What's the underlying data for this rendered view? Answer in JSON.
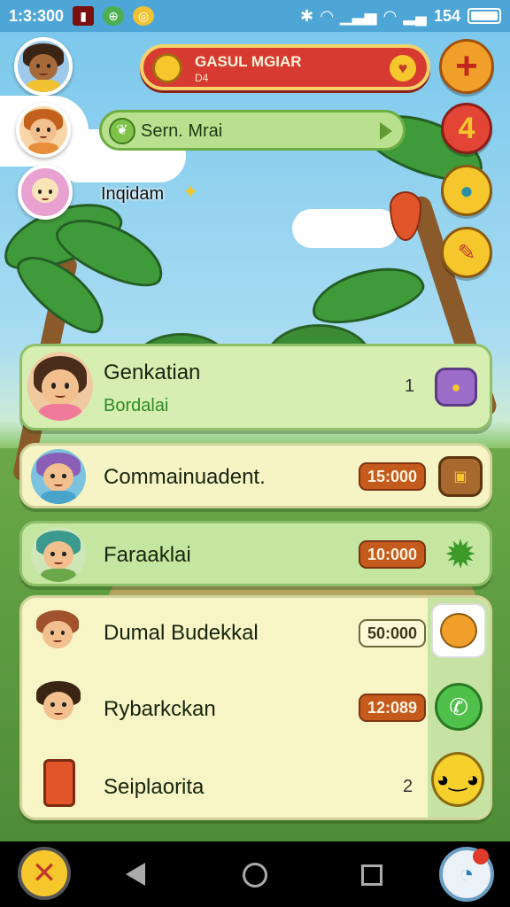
{
  "status_bar": {
    "time": "1:3:300",
    "battery_text": "154"
  },
  "top_banner": {
    "title": "GASUL MGIAR",
    "subtitle": "D4"
  },
  "side_buttons": {
    "plus": "+",
    "count": "4"
  },
  "search_pill": {
    "text": "Sern. Mrai"
  },
  "label_insta": "Inqidam",
  "cards": [
    {
      "title": "Genkatian",
      "subtitle": "Bordalai",
      "count": "1"
    },
    {
      "title": "Commainuadent.",
      "time": "15:000"
    },
    {
      "title": "Faraaklai",
      "time": "10:000"
    }
  ],
  "stack_items": [
    {
      "title": "Dumal Budekkal",
      "time": "50:000"
    },
    {
      "title": "Rybarkckan",
      "time": "12:089"
    },
    {
      "title": "Seiplaorita",
      "count": "2"
    }
  ],
  "colors": {
    "banner": "#d63a30",
    "badge": "#c45a1c",
    "card": "#d7eeb2",
    "accent_yellow": "#f6c72c"
  }
}
